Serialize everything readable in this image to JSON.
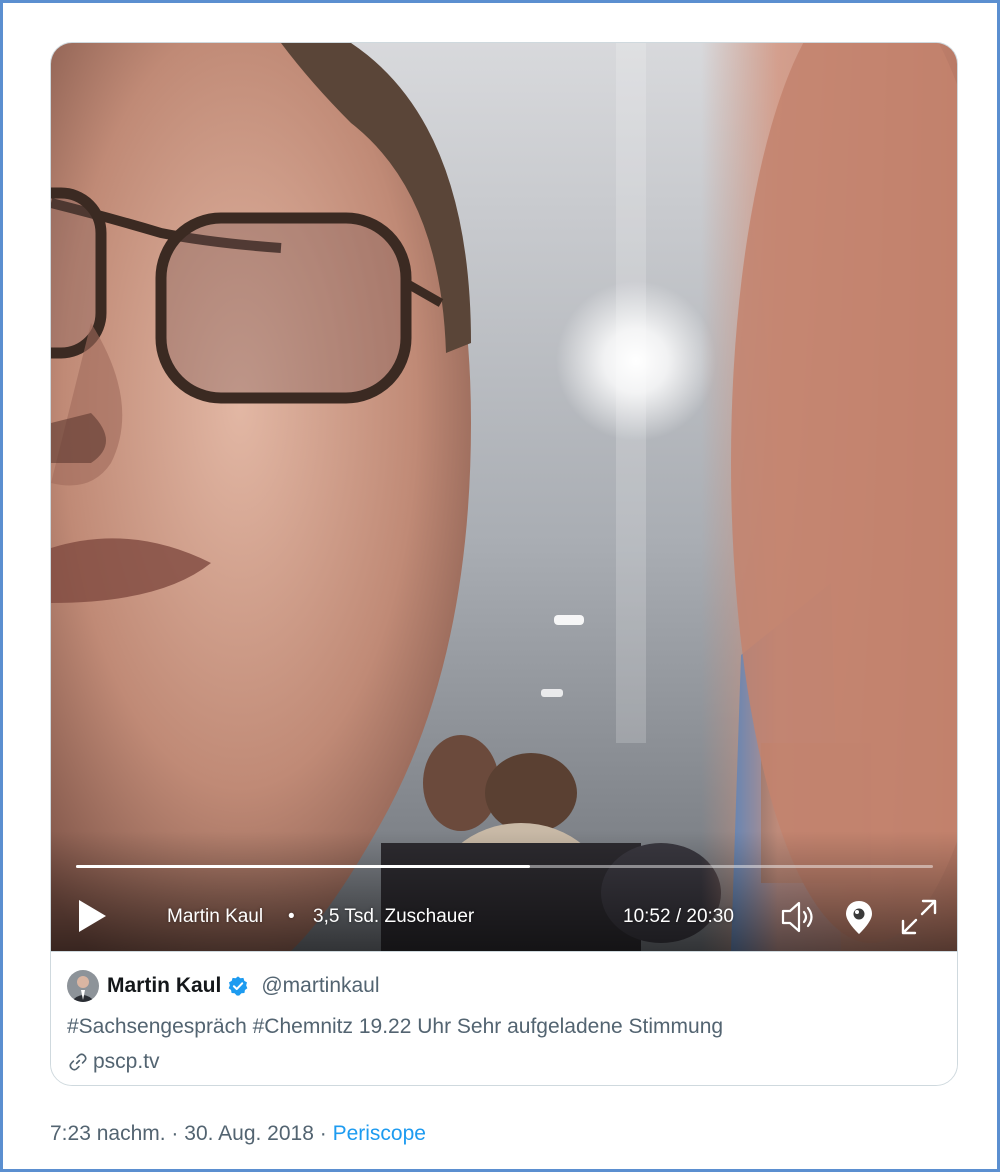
{
  "player": {
    "broadcaster": "Martin Kaul",
    "separator": "•",
    "viewers": "3,5 Tsd. Zuschauer",
    "time": "10:52 / 20:30",
    "progress": 0.53
  },
  "tweet": {
    "display_name": "Martin Kaul",
    "handle": "@martinkaul",
    "text": "#Sachsengespräch #Chemnitz 19.22 Uhr Sehr aufgeladene Stimmung",
    "link": "pscp.tv"
  },
  "meta": {
    "time": "7:23 nachm.",
    "dot1": "·",
    "date": "30. Aug. 2018",
    "dot2": "·",
    "source": "Periscope"
  },
  "colors": {
    "accent": "#1d9bf0",
    "frame_border": "#5b8fd0",
    "secondary_text": "#536471"
  },
  "icons": {
    "play": "play-icon",
    "volume": "volume-icon",
    "periscope": "periscope-icon",
    "fullscreen": "fullscreen-icon",
    "verified": "verified-badge-icon",
    "link": "link-icon"
  }
}
